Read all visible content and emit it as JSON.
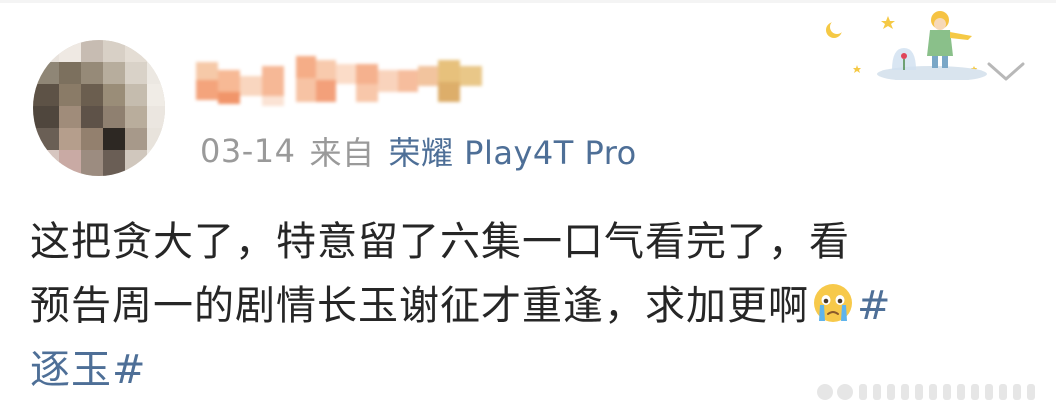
{
  "post": {
    "date": "03-14",
    "source_prefix": "来自",
    "device": "荣耀 Play4T Pro",
    "text_lines": [
      "这把贪大了，特意留了六集一口气看完了，看",
      "预告周一的剧情长玉谢征才重逢，求加更啊"
    ],
    "hashtag_line1": "#",
    "hashtag_line2": "逐玉#"
  },
  "icons": {
    "avatar": "avatar",
    "decoration": "little-prince-icon",
    "expand": "chevron-down-icon",
    "emoji": "crying-face-icon"
  },
  "colors": {
    "link": "#4e6f97",
    "meta": "#9a9a9a",
    "text": "#262626"
  }
}
